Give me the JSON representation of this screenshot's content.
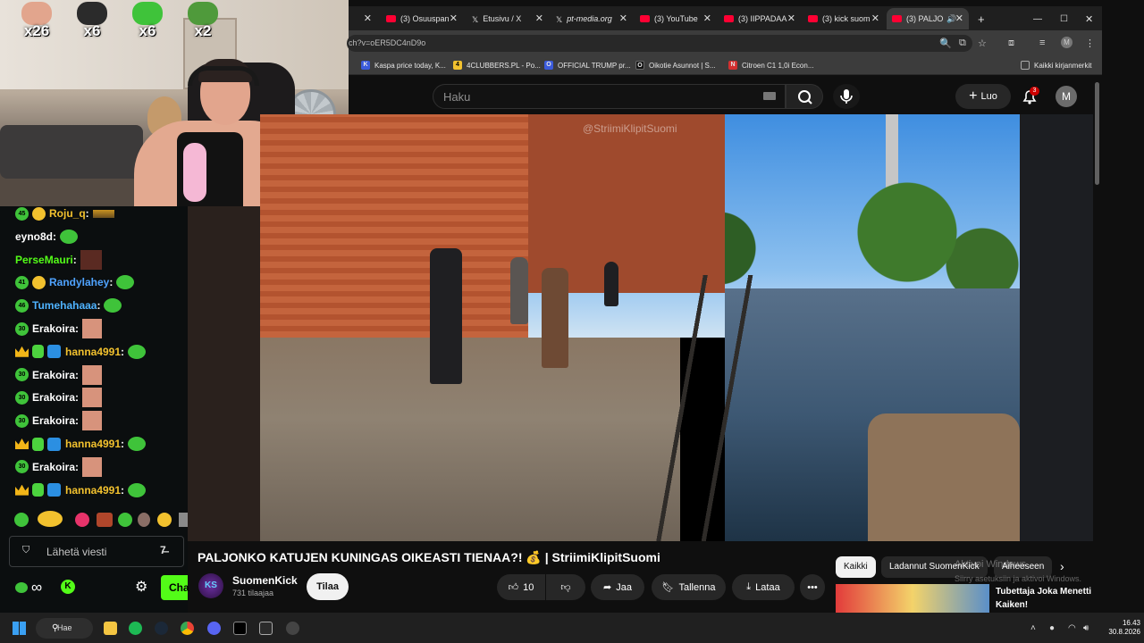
{
  "webcam": {
    "emote_counters": [
      {
        "count": "x26",
        "color": "#e2a58d"
      },
      {
        "count": "x6",
        "color": "#2b2b2b"
      },
      {
        "count": "x6",
        "color": "#3fc33a"
      },
      {
        "count": "x2",
        "color": "#4f9a3b"
      }
    ]
  },
  "browser": {
    "tabs": [
      {
        "label": "",
        "active": false,
        "favicon": "blank"
      },
      {
        "label": "(3) Osuuspan",
        "active": false,
        "favicon": "youtube-icon"
      },
      {
        "label": "Etusivu / X",
        "active": false,
        "favicon": "x-icon"
      },
      {
        "label": "pt-media.org",
        "active": false,
        "favicon": "x-icon"
      },
      {
        "label": "(3) YouTube",
        "active": false,
        "favicon": "youtube-icon"
      },
      {
        "label": "(3) IIPPADAA",
        "active": false,
        "favicon": "youtube-icon"
      },
      {
        "label": "(3) kick suom",
        "active": false,
        "favicon": "youtube-icon"
      },
      {
        "label": "(3) PALJO",
        "active": true,
        "favicon": "youtube-icon"
      }
    ],
    "new_tab": "+",
    "url": "ch?v=oER5DC4nD9o",
    "profile_initial": "M",
    "bookmarks": [
      {
        "label": "Kaspa price today, K...",
        "icon": "K",
        "color": "#3b5bdb"
      },
      {
        "label": "4CLUBBERS.PL - Po...",
        "icon": "4",
        "color": "#f2c12e"
      },
      {
        "label": "OFFICIAL TRUMP pr...",
        "icon": "O",
        "color": "#3b5bdb"
      },
      {
        "label": "Oikotie Asunnot | S...",
        "icon": "O",
        "color": "#111111"
      },
      {
        "label": "Citroen C1 1,0i Econ...",
        "icon": "N",
        "color": "#d32f2f"
      }
    ],
    "all_bookmarks": "Kaikki kirjanmerkit"
  },
  "youtube": {
    "search_placeholder": "Haku",
    "create_label": "Luo",
    "notification_count": "3",
    "avatar_initial": "M",
    "video_watermark": "@StriimiKlipitSuomi",
    "video_title": "PALJONKO KATUJEN KUNINGAS OIKEASTI TIENAA?! 💰 | StriimiKlipitSuomi",
    "channel_name": "SuomenKick",
    "channel_avatar": "KS",
    "subscribers": "731 tilaajaa",
    "subscribe_label": "Tilaa",
    "like_count": "10",
    "share_label": "Jaa",
    "save_label": "Tallenna",
    "download_label": "Lataa",
    "chips": [
      "Kaikki",
      "Ladannut SuomenKick",
      "Aiheeseen"
    ],
    "activate_windows_title": "Aktivoi Windows",
    "activate_windows_sub": "Siirry asetuksiin ja aktivoi Windows.",
    "recommended_title": "Tubettaja Joka Menetti Kaiken!"
  },
  "chat": {
    "messages": [
      {
        "badges": [
          "45",
          "coin"
        ],
        "user": "Roju_q",
        "color": "#f2c12e",
        "emote": "flag"
      },
      {
        "badges": [],
        "user": "eyno8d",
        "color": "#ffffff",
        "emote": "pepe"
      },
      {
        "badges": [],
        "user": "PerseMauri",
        "color": "#53fc18",
        "emote": "dark"
      },
      {
        "badges": [
          "41",
          "coin"
        ],
        "user": "Randylahey",
        "color": "#4fa3ff",
        "emote": "pepe"
      },
      {
        "badges": [
          "46"
        ],
        "user": "Tumehahaaa",
        "color": "#4fb3ff",
        "emote": "pepe"
      },
      {
        "badges": [
          "30"
        ],
        "user": "Erakoira",
        "color": "#ffffff",
        "emote": "face"
      },
      {
        "badges": [
          "crown",
          "gem",
          "box"
        ],
        "user": "hanna4991",
        "color": "#f2c12e",
        "emote": "pepe"
      },
      {
        "badges": [
          "30"
        ],
        "user": "Erakoira",
        "color": "#ffffff",
        "emote": "face"
      },
      {
        "badges": [
          "30"
        ],
        "user": "Erakoira",
        "color": "#ffffff",
        "emote": "face"
      },
      {
        "badges": [
          "30"
        ],
        "user": "Erakoira",
        "color": "#ffffff",
        "emote": "face"
      },
      {
        "badges": [
          "crown",
          "gem",
          "box"
        ],
        "user": "hanna4991",
        "color": "#f2c12e",
        "emote": "pepe"
      },
      {
        "badges": [
          "30"
        ],
        "user": "Erakoira",
        "color": "#ffffff",
        "emote": "face"
      },
      {
        "badges": [
          "crown",
          "gem",
          "box"
        ],
        "user": "hanna4991",
        "color": "#f2c12e",
        "emote": "pepe"
      }
    ],
    "input_placeholder": "Lähetä viesti",
    "send_label": "Cha"
  },
  "taskbar": {
    "search_label": "Hae",
    "time": "16.43",
    "date": "30.8.2026"
  }
}
